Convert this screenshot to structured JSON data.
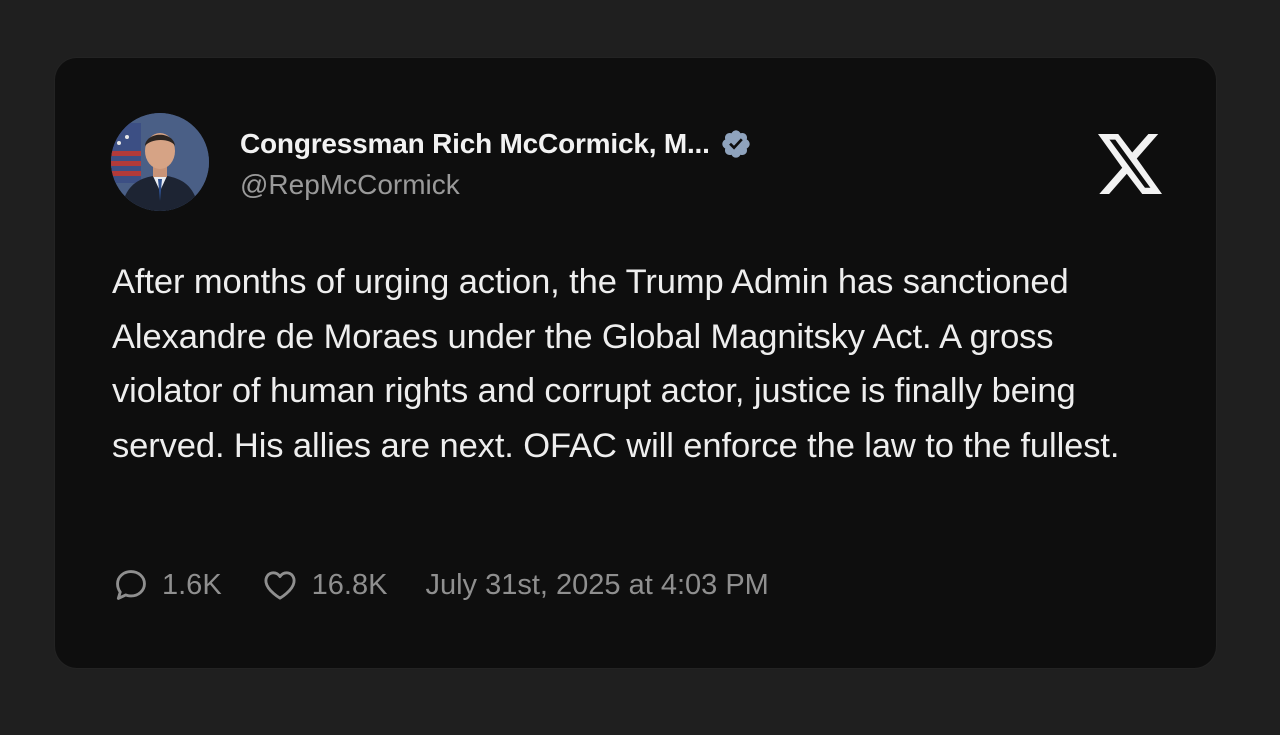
{
  "tweet": {
    "author": {
      "display_name": "Congressman Rich McCormick, M...",
      "handle": "@RepMcCormick",
      "verified": true,
      "verified_badge_color": "#8fa3bd",
      "avatar_icon": "profile-photo"
    },
    "platform_icon": "x-logo-icon",
    "text": "After months of urging action, the Trump Admin has sanctioned Alexandre de Moraes under the Global Magnitsky Act. A gross violator of human rights and corrupt actor, justice is finally being served. His allies are next. OFAC will enforce the law to the fullest.",
    "metrics": {
      "replies": "1.6K",
      "replies_icon": "speech-bubble-icon",
      "likes": "16.8K",
      "likes_icon": "heart-icon"
    },
    "timestamp": "July 31st, 2025 at 4:03 PM"
  },
  "colors": {
    "page_background": "#1f1f1f",
    "card_background": "#0e0e0e",
    "primary_text": "#eeeeee",
    "secondary_text": "#8f8f8f"
  }
}
